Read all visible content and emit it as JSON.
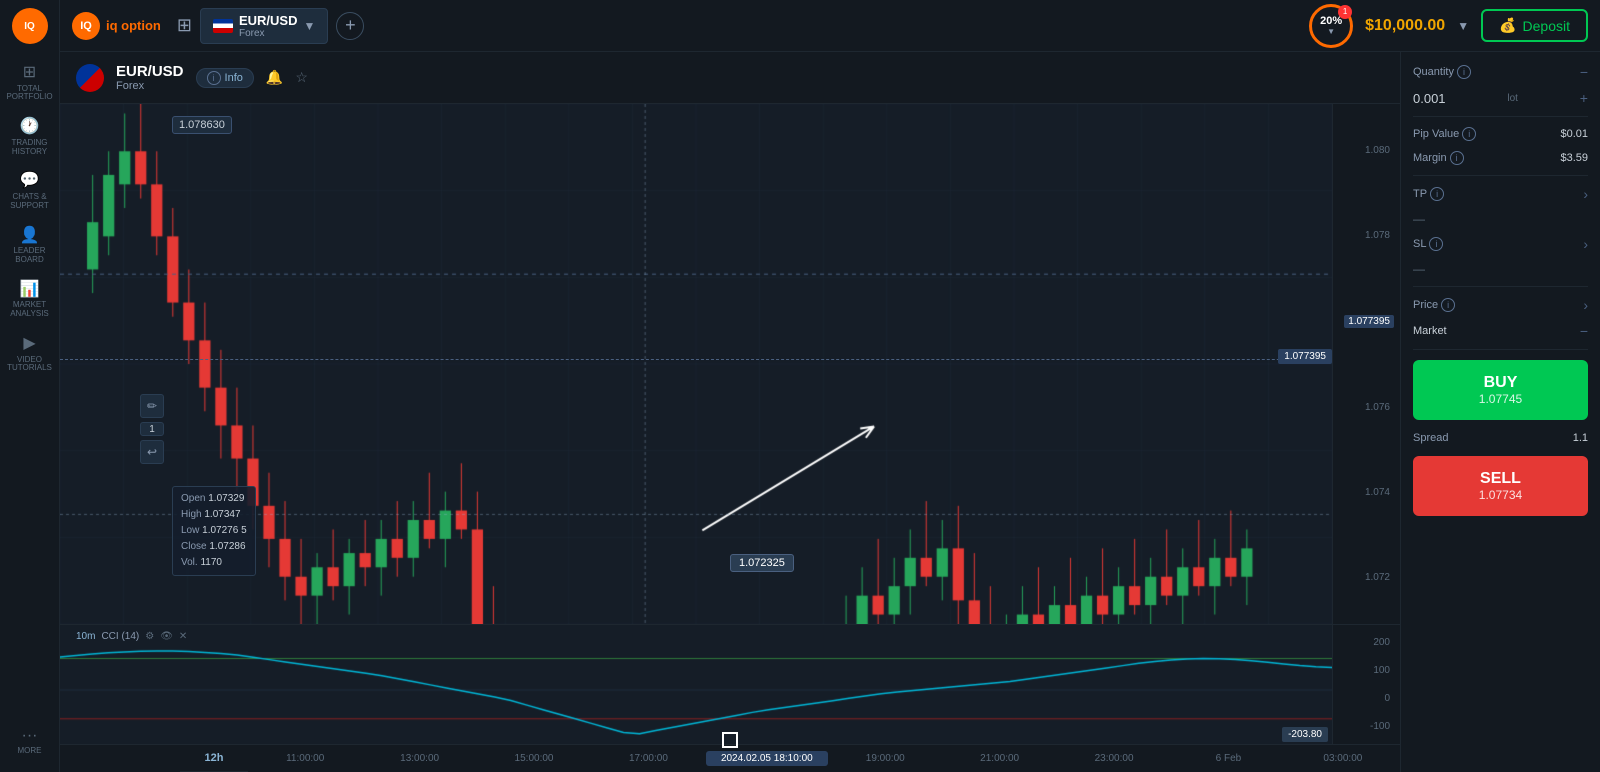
{
  "app": {
    "name": "IQ Option",
    "logo_text": "iq option"
  },
  "topbar": {
    "instrument": {
      "name": "EUR/USD",
      "sub": "Forex"
    },
    "add_button": "+",
    "risk_percent": "20%",
    "balance": "$10,000.00",
    "deposit_label": "Deposit",
    "notification_count": "1"
  },
  "sidebar": {
    "items": [
      {
        "id": "total-portfolio",
        "icon": "⊞",
        "label": "TOTAL\nPORTFOLIO"
      },
      {
        "id": "trading-history",
        "icon": "🕐",
        "label": "TRADING\nHISTORY"
      },
      {
        "id": "chats-support",
        "icon": "💬",
        "label": "CHATS &\nSUPPORT"
      },
      {
        "id": "leaderboard",
        "icon": "👤",
        "label": "LEADER\nBOARD"
      },
      {
        "id": "market-analysis",
        "icon": "📊",
        "label": "MARKET\nANALYSIS"
      },
      {
        "id": "video-tutorials",
        "icon": "▶",
        "label": "VIDEO\nTUTORIALS"
      },
      {
        "id": "more",
        "icon": "···",
        "label": "MORE"
      }
    ]
  },
  "chart_header": {
    "pair": "EUR/USD",
    "pair_sub": "Forex",
    "info_label": "Info",
    "price_line": "1.078630",
    "crosshair_price": "1.072325",
    "dashed_price": "1.077395"
  },
  "ohlcv": {
    "open_label": "Open",
    "open_val": "1.07329",
    "high_label": "High",
    "high_val": "1.07347",
    "low_label": "Low",
    "low_val": "1.07276 5",
    "close_label": "Close",
    "close_val": "1.07286",
    "vol_label": "Vol.",
    "vol_val": "1170"
  },
  "y_axis": {
    "labels": [
      "1.080",
      "1.078",
      "1.076",
      "1.074",
      "1.072"
    ],
    "current": "1.077395"
  },
  "indicator": {
    "label": "CCI (14)",
    "timeframe": "10m",
    "bottom_value": "-203.80",
    "y_labels": [
      "200",
      "100",
      "0",
      "-100"
    ]
  },
  "time_axis": {
    "labels": [
      "11:00:00",
      "13:00:00",
      "15:00:00",
      "17:00:00",
      "2024.02.05 18:10:00",
      "19:00:00",
      "21:00:00",
      "23:00:00",
      "6 Feb",
      "03:00:00"
    ],
    "active_index": 4
  },
  "right_panel": {
    "quantity_label": "Quantity",
    "quantity_value": "0.001",
    "quantity_unit": "lot",
    "pip_value_label": "Pip Value",
    "pip_value": "$0.01",
    "margin_label": "Margin",
    "margin_value": "$3.59",
    "tp_label": "TP",
    "tp_value": "—",
    "sl_label": "SL",
    "sl_value": "—",
    "price_label": "Price",
    "price_value": "Market",
    "price_market": "Market",
    "buy_label": "BUY",
    "buy_price": "1.07745",
    "sell_label": "SELL",
    "sell_price": "1.07734",
    "spread_label": "Spread",
    "spread_value": "1.1"
  }
}
